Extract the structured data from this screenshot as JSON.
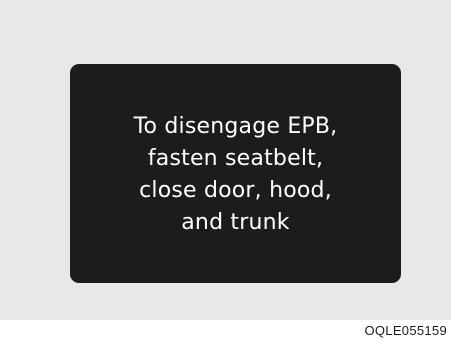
{
  "display": {
    "message_lines": [
      "To disengage EPB,",
      "fasten seatbelt,",
      "close door, hood,",
      "and trunk"
    ],
    "background_color": "#1c1c1c",
    "text_color": "#ffffff"
  },
  "frame": {
    "background_color": "#e8e8e8"
  },
  "figure_code": "OQLE055159"
}
